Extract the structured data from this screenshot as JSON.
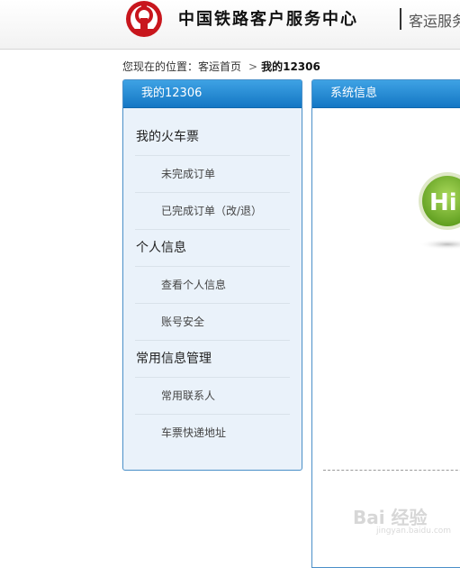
{
  "header": {
    "site_title": "中国铁路客户服务中心",
    "site_subtitle": "客运服务"
  },
  "breadcrumb": {
    "prefix": "您现在的位置：",
    "home": "客运首页",
    "separator": ">",
    "current": "我的12306"
  },
  "left_panel": {
    "title": "我的12306",
    "groups": [
      {
        "label": "我的火车票",
        "items": [
          "未完成订单",
          "已完成订单（改/退）"
        ]
      },
      {
        "label": "个人信息",
        "items": [
          "查看个人信息",
          "账号安全"
        ]
      },
      {
        "label": "常用信息管理",
        "items": [
          "常用联系人",
          "车票快递地址"
        ]
      }
    ]
  },
  "right_panel": {
    "title": "系统信息",
    "badge_text": "Hi!"
  },
  "watermark": {
    "text": "Bai 经验",
    "sub": "jingyan.baidu.com"
  },
  "colors": {
    "panel_header": "#1e88d4",
    "logo_red": "#c8161d",
    "badge_green": "#7cb82f"
  }
}
